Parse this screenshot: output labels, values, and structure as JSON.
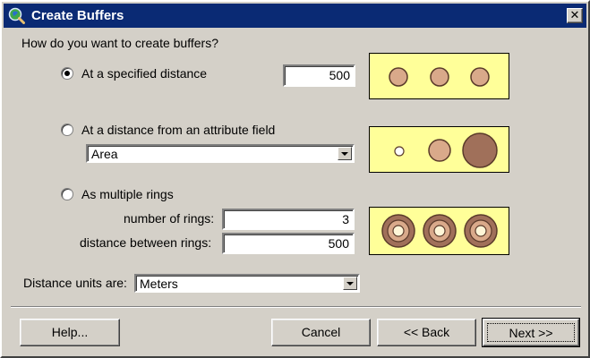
{
  "window": {
    "title": "Create Buffers",
    "close_label": "✕"
  },
  "question": "How do you want to create buffers?",
  "options": {
    "specified_distance": {
      "label": "At a specified distance",
      "selected": true,
      "value": "500"
    },
    "attribute_field": {
      "label": "At a distance from an attribute field",
      "selected": false,
      "field_value": "Area"
    },
    "multiple_rings": {
      "label": "As multiple rings",
      "selected": false,
      "rings_label": "number of rings:",
      "rings_value": "3",
      "distance_label": "distance between rings:",
      "distance_value": "500"
    }
  },
  "units": {
    "label": "Distance units are:",
    "value": "Meters"
  },
  "buttons": {
    "help": "Help...",
    "cancel": "Cancel",
    "back": "<< Back",
    "next": "Next >>"
  },
  "colors": {
    "titlebar": "#0a2a74",
    "dialog_bg": "#d4d0c8",
    "preview_bg": "#ffff99",
    "buffer_fill": "#d9a98a",
    "buffer_outline": "#5a3a2a",
    "buffer_dark": "#a0705a"
  }
}
